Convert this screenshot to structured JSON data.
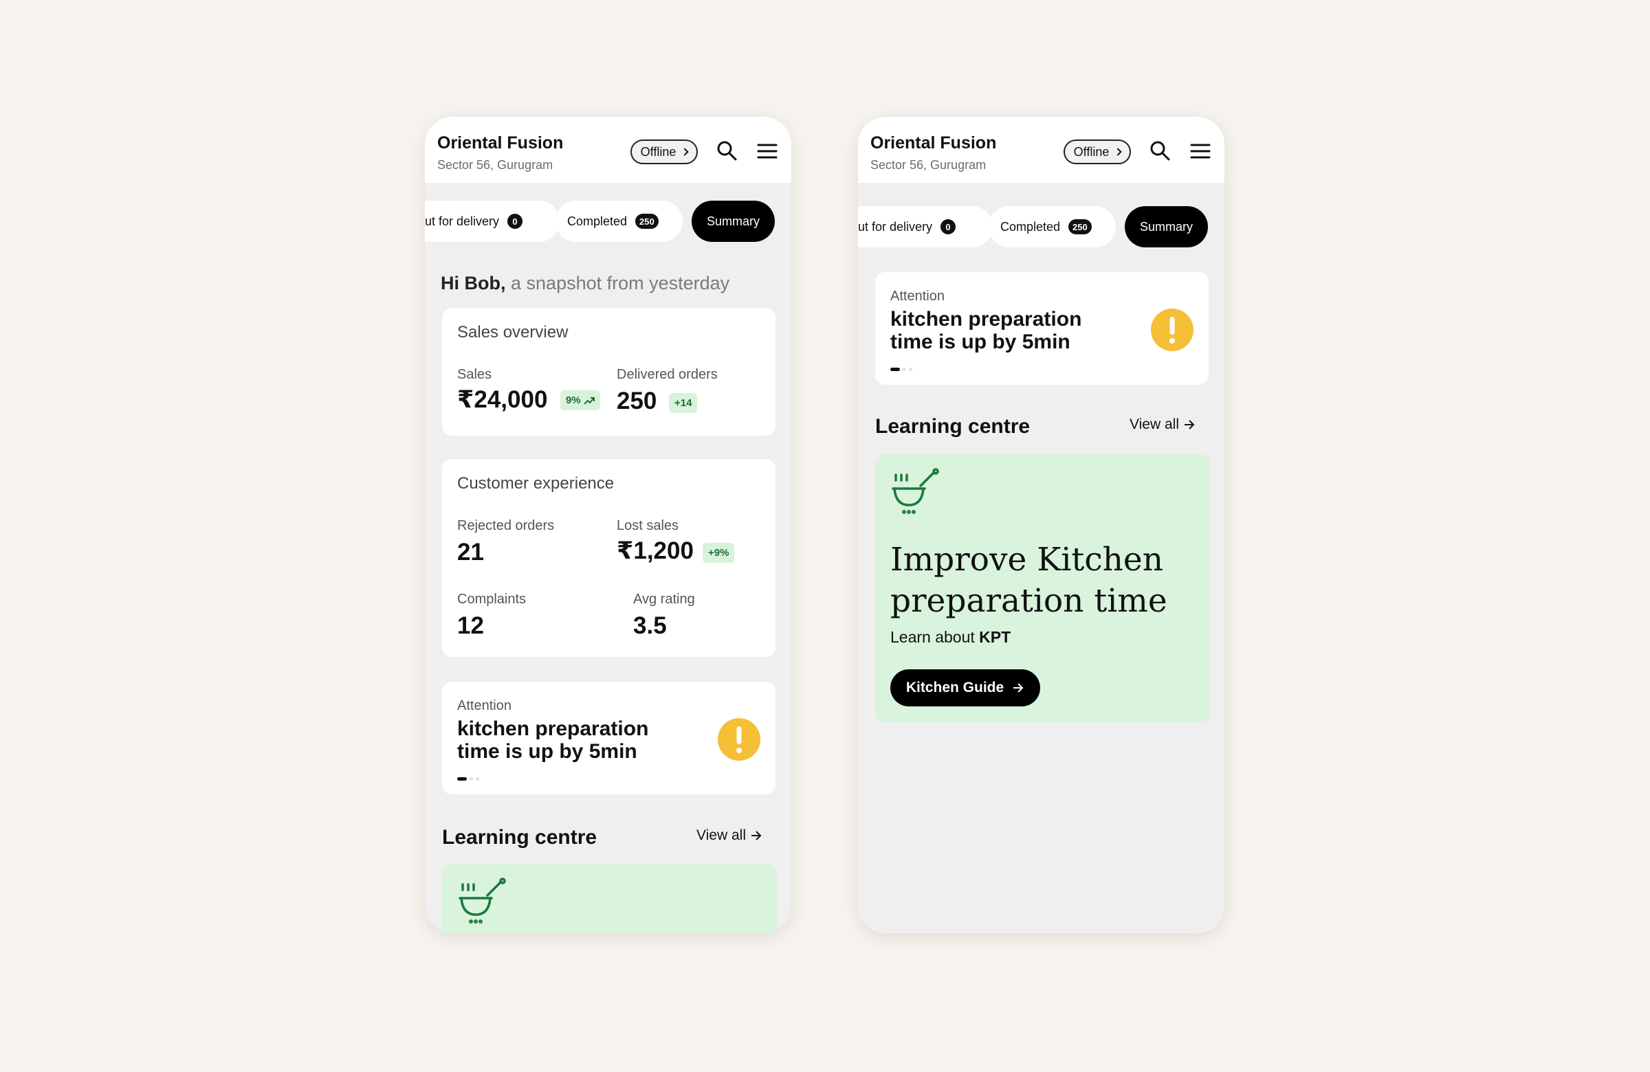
{
  "store": {
    "name": "Oriental Fusion",
    "location": "Sector 56, Gurugram",
    "status": "Offline"
  },
  "tabs": {
    "delivery_label": "ut for delivery",
    "delivery_count": "0",
    "completed_label": "Completed",
    "completed_count": "250",
    "summary_label": "Summary"
  },
  "greeting": {
    "name": "Hi Bob,",
    "text": "a snapshot from yesterday"
  },
  "sales_overview": {
    "title": "Sales overview",
    "sales_label": "Sales",
    "sales_value": "₹24,000",
    "sales_delta": "9%",
    "orders_label": "Delivered orders",
    "orders_value": "250",
    "orders_delta": "+14"
  },
  "customer_experience": {
    "title": "Customer experience",
    "rejected_label": "Rejected orders",
    "rejected_value": "21",
    "lost_label": "Lost sales",
    "lost_value": "₹1,200",
    "lost_delta": "+9%",
    "complaints_label": "Complaints",
    "complaints_value": "12",
    "rating_label": "Avg rating",
    "rating_value": "3.5"
  },
  "attention": {
    "label": "Attention",
    "text": "kitchen preparation time is up by 5min",
    "icon": "alert-icon",
    "accent": "#f5bf36",
    "pages": 3,
    "current_page": 1
  },
  "learning": {
    "title": "Learning centre",
    "view_all": "View all",
    "card_icon": "cooking-pot-icon",
    "card_heading": "Improve Kitchen preparation time",
    "card_sub_prefix": "Learn about",
    "card_sub_bold": "KPT",
    "button_label": "Kitchen Guide",
    "card_color": "#d9f3dd",
    "icon_color": "#1b7a3a"
  },
  "colors": {
    "page_bg": "#f7f3ee",
    "screen_bg": "#efefef",
    "positive_bg": "#d9f2dc",
    "positive_text": "#1e6b34"
  }
}
